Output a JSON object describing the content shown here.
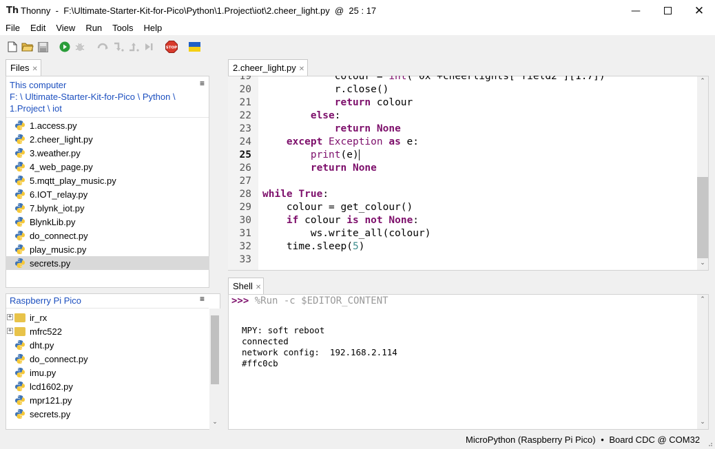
{
  "window": {
    "app": "Thonny",
    "path": "F:\\Ultimate-Starter-Kit-for-Pico\\Python\\1.Project\\iot\\2.cheer_light.py",
    "cursor": "25 : 17",
    "title_sep": "-",
    "at": "@"
  },
  "menu": [
    "File",
    "Edit",
    "View",
    "Run",
    "Tools",
    "Help"
  ],
  "files_panel": {
    "tab": "Files",
    "section_title": "This computer",
    "breadcrumb_line1": "F: \\ Ultimate-Starter-Kit-for-Pico \\ Python \\",
    "breadcrumb_line2": "1.Project \\ iot",
    "files": [
      "1.access.py",
      "2.cheer_light.py",
      "3.weather.py",
      "4_web_page.py",
      "5.mqtt_play_music.py",
      "6.IOT_relay.py",
      "7.blynk_iot.py",
      "BlynkLib.py",
      "do_connect.py",
      "play_music.py",
      "secrets.py"
    ],
    "selected": "secrets.py"
  },
  "pico_panel": {
    "title": "Raspberry Pi Pico",
    "folders": [
      "ir_rx",
      "mfrc522"
    ],
    "files": [
      "dht.py",
      "do_connect.py",
      "imu.py",
      "lcd1602.py",
      "mpr121.py",
      "secrets.py"
    ]
  },
  "editor": {
    "tab": "2.cheer_light.py",
    "line_numbers": [
      "19",
      "20",
      "21",
      "22",
      "23",
      "24",
      "25",
      "26",
      "27",
      "28",
      "29",
      "30",
      "31",
      "32",
      "33"
    ],
    "current_line": "25"
  },
  "shell": {
    "tab": "Shell",
    "prompt": ">>>",
    "command": "%Run -c $EDITOR_CONTENT",
    "output": [
      "MPY: soft reboot",
      "connected",
      "network config:  192.168.2.114",
      "#ffc0cb"
    ]
  },
  "status": {
    "interpreter": "MicroPython (Raspberry Pi Pico)",
    "separator": "•",
    "port": "Board CDC @ COM32"
  },
  "icons": {
    "new": "new-file-icon",
    "open": "open-folder-icon",
    "save": "save-icon",
    "run": "run-icon",
    "debug": "debug-icon",
    "step_over": "step-over-icon",
    "step_into": "step-into-icon",
    "step_out": "step-out-icon",
    "resume": "resume-icon",
    "stop": "stop-icon",
    "flag": "support-ukraine-icon"
  },
  "colors": {
    "keyword": "#7d0f6b",
    "number": "#3e8d8d",
    "link": "#1c4fbf",
    "selection": "#d9d9d9",
    "stop": "#d83a2c",
    "run": "#2a9d3a"
  }
}
